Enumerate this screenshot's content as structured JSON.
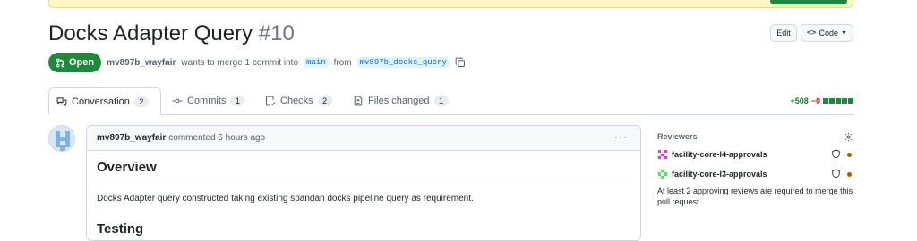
{
  "pr": {
    "title": "Docks Adapter Query",
    "number": "#10",
    "state": "Open",
    "author": "mv897b_wayfair",
    "merge_text": "wants to merge 1 commit into",
    "base_branch": "main",
    "from_text": "from",
    "head_branch": "mv897b_docks_query"
  },
  "header_buttons": {
    "edit": "Edit",
    "code": "Code"
  },
  "tabs": [
    {
      "label": "Conversation",
      "count": "2"
    },
    {
      "label": "Commits",
      "count": "1"
    },
    {
      "label": "Checks",
      "count": "2"
    },
    {
      "label": "Files changed",
      "count": "1"
    }
  ],
  "diffstat": {
    "additions": "+508",
    "deletions": "−0"
  },
  "comment": {
    "author": "mv897b_wayfair",
    "action": "commented 6 hours ago",
    "heading": "Overview",
    "paragraph": "Docks Adapter query constructed taking existing spandan docks pipeline query as requirement.",
    "heading2": "Testing"
  },
  "sidebar": {
    "reviewers_title": "Reviewers",
    "reviewers": [
      {
        "name": "facility-core-l4-approvals",
        "avatar_color": "#c34cc4"
      },
      {
        "name": "facility-core-l3-approvals",
        "avatar_color": "#6fcf7b"
      }
    ],
    "note": "At least 2 approving reviews are required to merge this pull request."
  },
  "colors": {
    "open_green": "#1f883d",
    "link_blue": "#0969da",
    "pending_dot": "#9a6700"
  }
}
